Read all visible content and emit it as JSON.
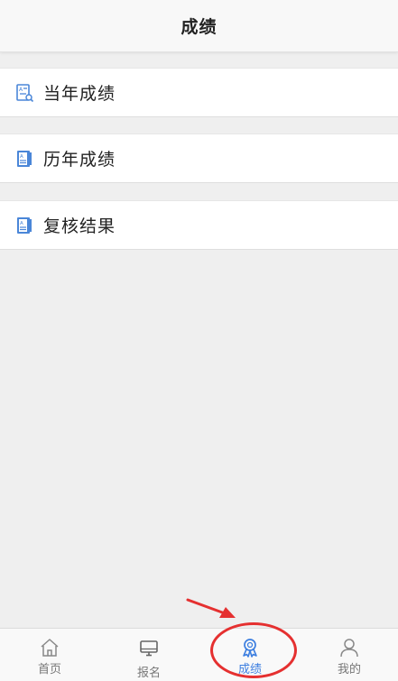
{
  "header": {
    "title": "成绩"
  },
  "menu": [
    {
      "label": "当年成绩",
      "icon": "report-search-icon"
    },
    {
      "label": "历年成绩",
      "icon": "report-book-icon"
    },
    {
      "label": "复核结果",
      "icon": "report-book-icon"
    }
  ],
  "tabbar": {
    "tabs": [
      {
        "label": "首页",
        "icon": "home-icon",
        "active": false
      },
      {
        "label": "报名",
        "icon": "monitor-icon",
        "active": false
      },
      {
        "label": "成绩",
        "icon": "medal-icon",
        "active": true
      },
      {
        "label": "我的",
        "icon": "user-icon",
        "active": false
      }
    ]
  },
  "colors": {
    "accent": "#3d7fe0",
    "icon_blue": "#4a86d8",
    "annotation_red": "#e53030",
    "background": "#efefef"
  }
}
